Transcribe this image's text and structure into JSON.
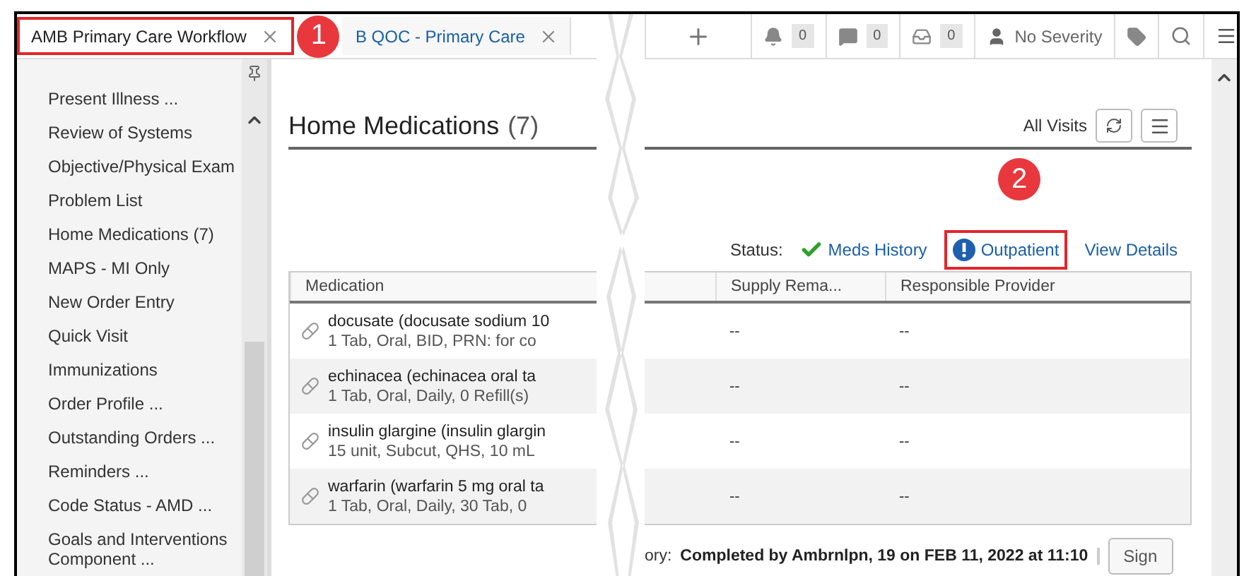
{
  "tabs": [
    {
      "label": "AMB Primary Care Workflow",
      "selected": true,
      "highlighted": true
    },
    {
      "label": "B QOC - Primary Care",
      "selected": false,
      "highlighted": false
    }
  ],
  "toolbar": {
    "counters": [
      {
        "kind": "bell",
        "count": "0"
      },
      {
        "kind": "chat",
        "count": "0"
      },
      {
        "kind": "inbox",
        "count": "0"
      }
    ],
    "severity": "No Severity"
  },
  "sidebar": {
    "items": [
      {
        "label": "Present Illness ...",
        "selected": false
      },
      {
        "label": "Review of Systems",
        "selected": false
      },
      {
        "label": "Objective/Physical Exam",
        "selected": false
      },
      {
        "label": "Problem List",
        "selected": false
      },
      {
        "label": "Home Medications (7)",
        "selected": false
      },
      {
        "label": "MAPS - MI Only",
        "selected": false
      },
      {
        "label": "New Order Entry",
        "selected": false
      },
      {
        "label": "Quick Visit",
        "selected": false
      },
      {
        "label": "Immunizations",
        "selected": false
      },
      {
        "label": "Order Profile ...",
        "selected": false
      },
      {
        "label": "Outstanding Orders ...",
        "selected": false
      },
      {
        "label": "Reminders ...",
        "selected": false
      },
      {
        "label": "Code Status - AMD ...",
        "selected": false
      },
      {
        "label": "Goals and Interventions Component ...",
        "selected": false
      }
    ]
  },
  "section": {
    "title": "Home Medications",
    "count": "(7)",
    "filter": "All Visits",
    "status": {
      "label": "Status:",
      "links": [
        {
          "kind": "check",
          "text": "Meds History",
          "highlighted": false
        },
        {
          "kind": "info",
          "text": "Outpatient",
          "highlighted": true
        },
        {
          "kind": "plain",
          "text": "View Details",
          "highlighted": false
        }
      ]
    }
  },
  "table": {
    "columns": [
      "Medication",
      "Supply Rema...",
      "Responsible Provider"
    ],
    "rows": [
      {
        "name": "docusate (docusate sodium 10",
        "detail": "1 Tab, Oral, BID, PRN: for co",
        "supply": "--",
        "provider": "--"
      },
      {
        "name": "echinacea (echinacea oral ta",
        "detail": "1 Tab, Oral, Daily, 0 Refill(s)",
        "supply": "--",
        "provider": "--"
      },
      {
        "name": "insulin glargine (insulin glargin",
        "detail": "15 unit, Subcut, QHS, 10 mL",
        "supply": "--",
        "provider": "--"
      },
      {
        "name": "warfarin (warfarin 5 mg oral ta",
        "detail": "1 Tab, Oral, Daily, 30 Tab, 0",
        "supply": "--",
        "provider": "--"
      }
    ]
  },
  "footer": {
    "label": "ory:",
    "text": "Completed by Ambrnlpn, 19 on FEB 11, 2022 at 11:10",
    "button": "Sign"
  },
  "annotations": [
    {
      "number": "1"
    },
    {
      "number": "2"
    }
  ]
}
